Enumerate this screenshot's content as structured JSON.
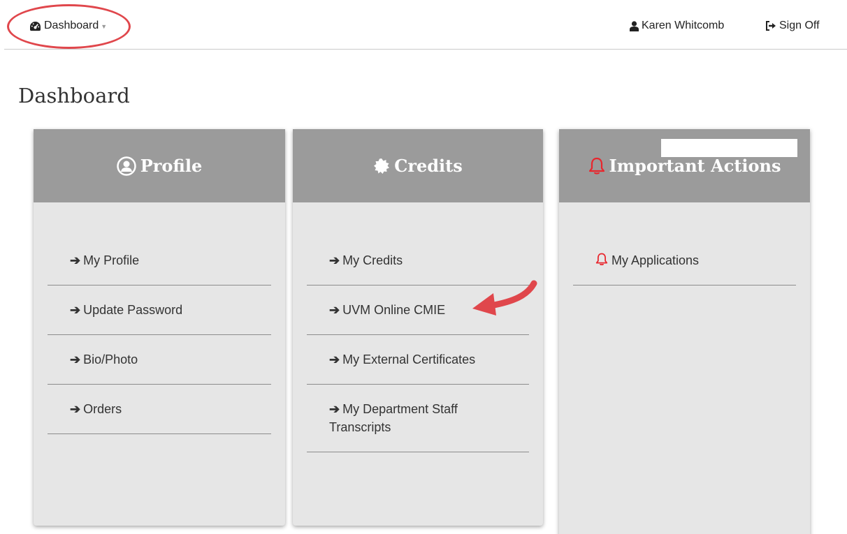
{
  "nav": {
    "dashboard_label": "Dashboard",
    "user_name": "Karen Whitcomb",
    "sign_off_label": "Sign Off"
  },
  "page": {
    "title": "Dashboard"
  },
  "cards": {
    "profile": {
      "title": "Profile",
      "items": [
        "My Profile",
        "Update Password",
        "Bio/Photo",
        "Orders"
      ]
    },
    "credits": {
      "title": "Credits",
      "items": [
        "My Credits",
        "UVM Online CMIE",
        "My External Certificates",
        "My Department Staff Transcripts"
      ]
    },
    "actions": {
      "title": "Important Actions",
      "items": [
        "My Applications"
      ]
    }
  },
  "icons": {
    "dashboard": "tachometer-icon",
    "user": "user-icon",
    "sign_off": "sign-out-icon",
    "profile": "user-circle-icon",
    "credits": "certificate-icon",
    "actions": "bell-icon",
    "item": "arrow-right-icon"
  },
  "colors": {
    "header_bg": "#9b9b9b",
    "card_bg": "#e6e6e6",
    "alert_red": "#e8262d",
    "annotation_red": "#e0474c"
  }
}
